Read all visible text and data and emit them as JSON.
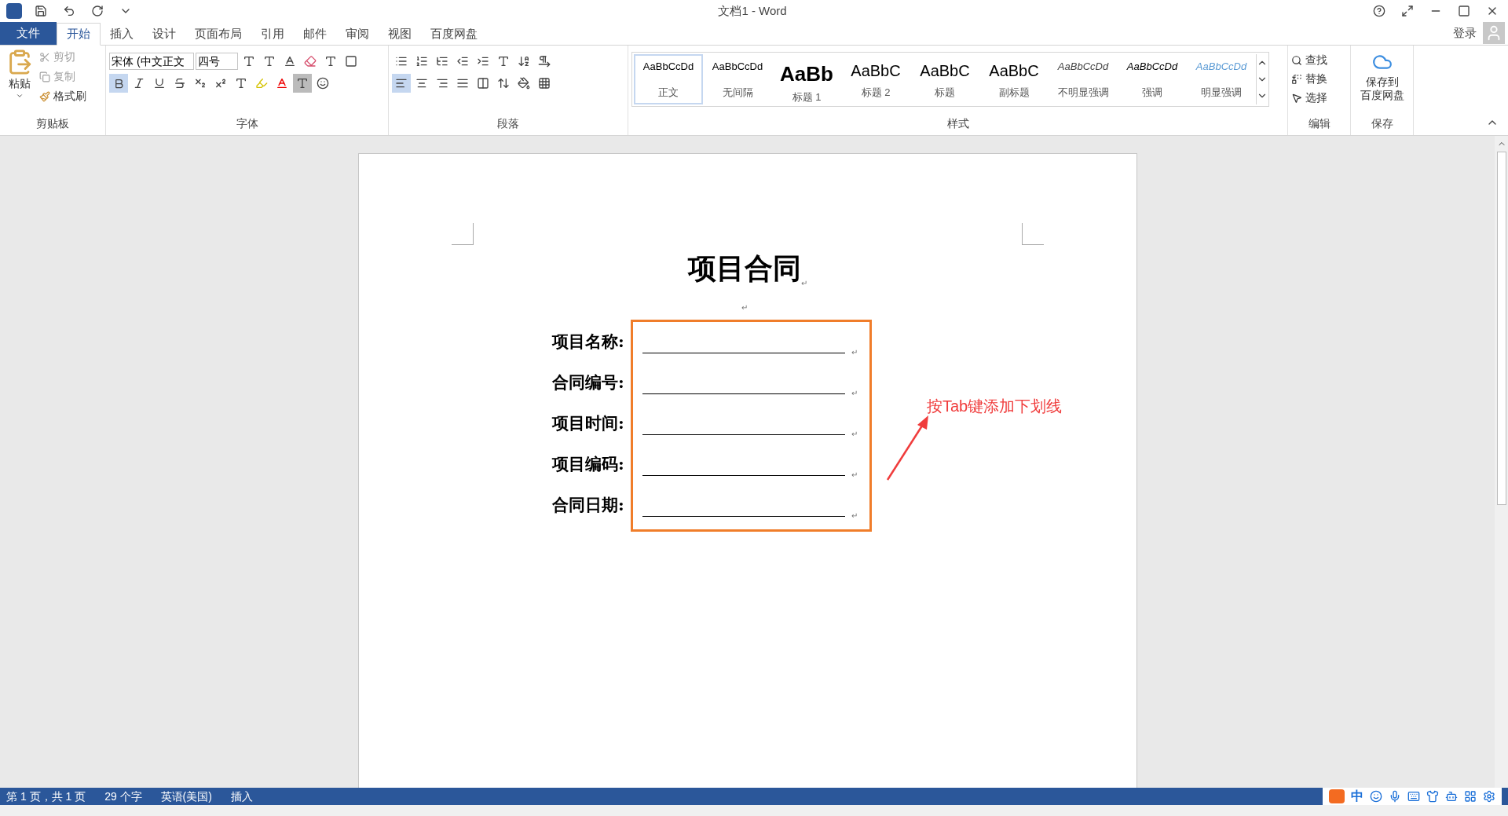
{
  "window": {
    "title": "文档1 - Word",
    "sign_in": "登录"
  },
  "tabs": [
    {
      "label": "文件",
      "kind": "file",
      "selected": false
    },
    {
      "label": "开始",
      "kind": "tab",
      "selected": true
    },
    {
      "label": "插入",
      "kind": "tab",
      "selected": false
    },
    {
      "label": "设计",
      "kind": "tab",
      "selected": false
    },
    {
      "label": "页面布局",
      "kind": "tab",
      "selected": false
    },
    {
      "label": "引用",
      "kind": "tab",
      "selected": false
    },
    {
      "label": "邮件",
      "kind": "tab",
      "selected": false
    },
    {
      "label": "审阅",
      "kind": "tab",
      "selected": false
    },
    {
      "label": "视图",
      "kind": "tab",
      "selected": false
    },
    {
      "label": "百度网盘",
      "kind": "tab",
      "selected": false
    }
  ],
  "clipboard": {
    "label": "剪贴板",
    "paste": "粘贴",
    "items": [
      {
        "label": "剪切",
        "disabled": true
      },
      {
        "label": "复制",
        "disabled": true
      },
      {
        "label": "格式刷",
        "disabled": false
      }
    ]
  },
  "font": {
    "label": "字体",
    "family": "宋体 (中文正文",
    "size": "四号",
    "bold": true
  },
  "paragraph": {
    "label": "段落",
    "align_left": true
  },
  "styles": {
    "label": "样式",
    "items": [
      {
        "preview": "AaBbCcDd",
        "name": "正文",
        "kind": "normal",
        "selected": true
      },
      {
        "preview": "AaBbCcDd",
        "name": "无间隔",
        "kind": "normal",
        "selected": false
      },
      {
        "preview": "AaBb",
        "name": "标题 1",
        "kind": "h1",
        "selected": false
      },
      {
        "preview": "AaBbC",
        "name": "标题 2",
        "kind": "h2",
        "selected": false
      },
      {
        "preview": "AaBbC",
        "name": "标题",
        "kind": "h2",
        "selected": false
      },
      {
        "preview": "AaBbC",
        "name": "副标题",
        "kind": "h2",
        "selected": false
      },
      {
        "preview": "AaBbCcDd",
        "name": "不明显强调",
        "kind": "italic",
        "selected": false
      },
      {
        "preview": "AaBbCcDd",
        "name": "强调",
        "kind": "italic-dark",
        "selected": false
      },
      {
        "preview": "AaBbCcDd",
        "name": "明显强调",
        "kind": "italic-blue",
        "selected": false
      }
    ]
  },
  "editing": {
    "label": "编辑",
    "items": [
      "查找",
      "替换",
      "选择"
    ]
  },
  "save": {
    "label": "保存",
    "button": [
      "保存到",
      "百度网盘"
    ]
  },
  "document": {
    "title": "项目合同",
    "mark": "↵",
    "fields": [
      {
        "label": "项目名称:"
      },
      {
        "label": "合同编号:"
      },
      {
        "label": "项目时间:"
      },
      {
        "label": "项目编码:"
      },
      {
        "label": "合同日期:"
      }
    ],
    "annotation": "按Tab键添加下划线"
  },
  "status_bar": {
    "items": [
      "第 1 页，共 1 页",
      "29 个字",
      "英语(美国)",
      "插入"
    ],
    "ime": "中"
  }
}
